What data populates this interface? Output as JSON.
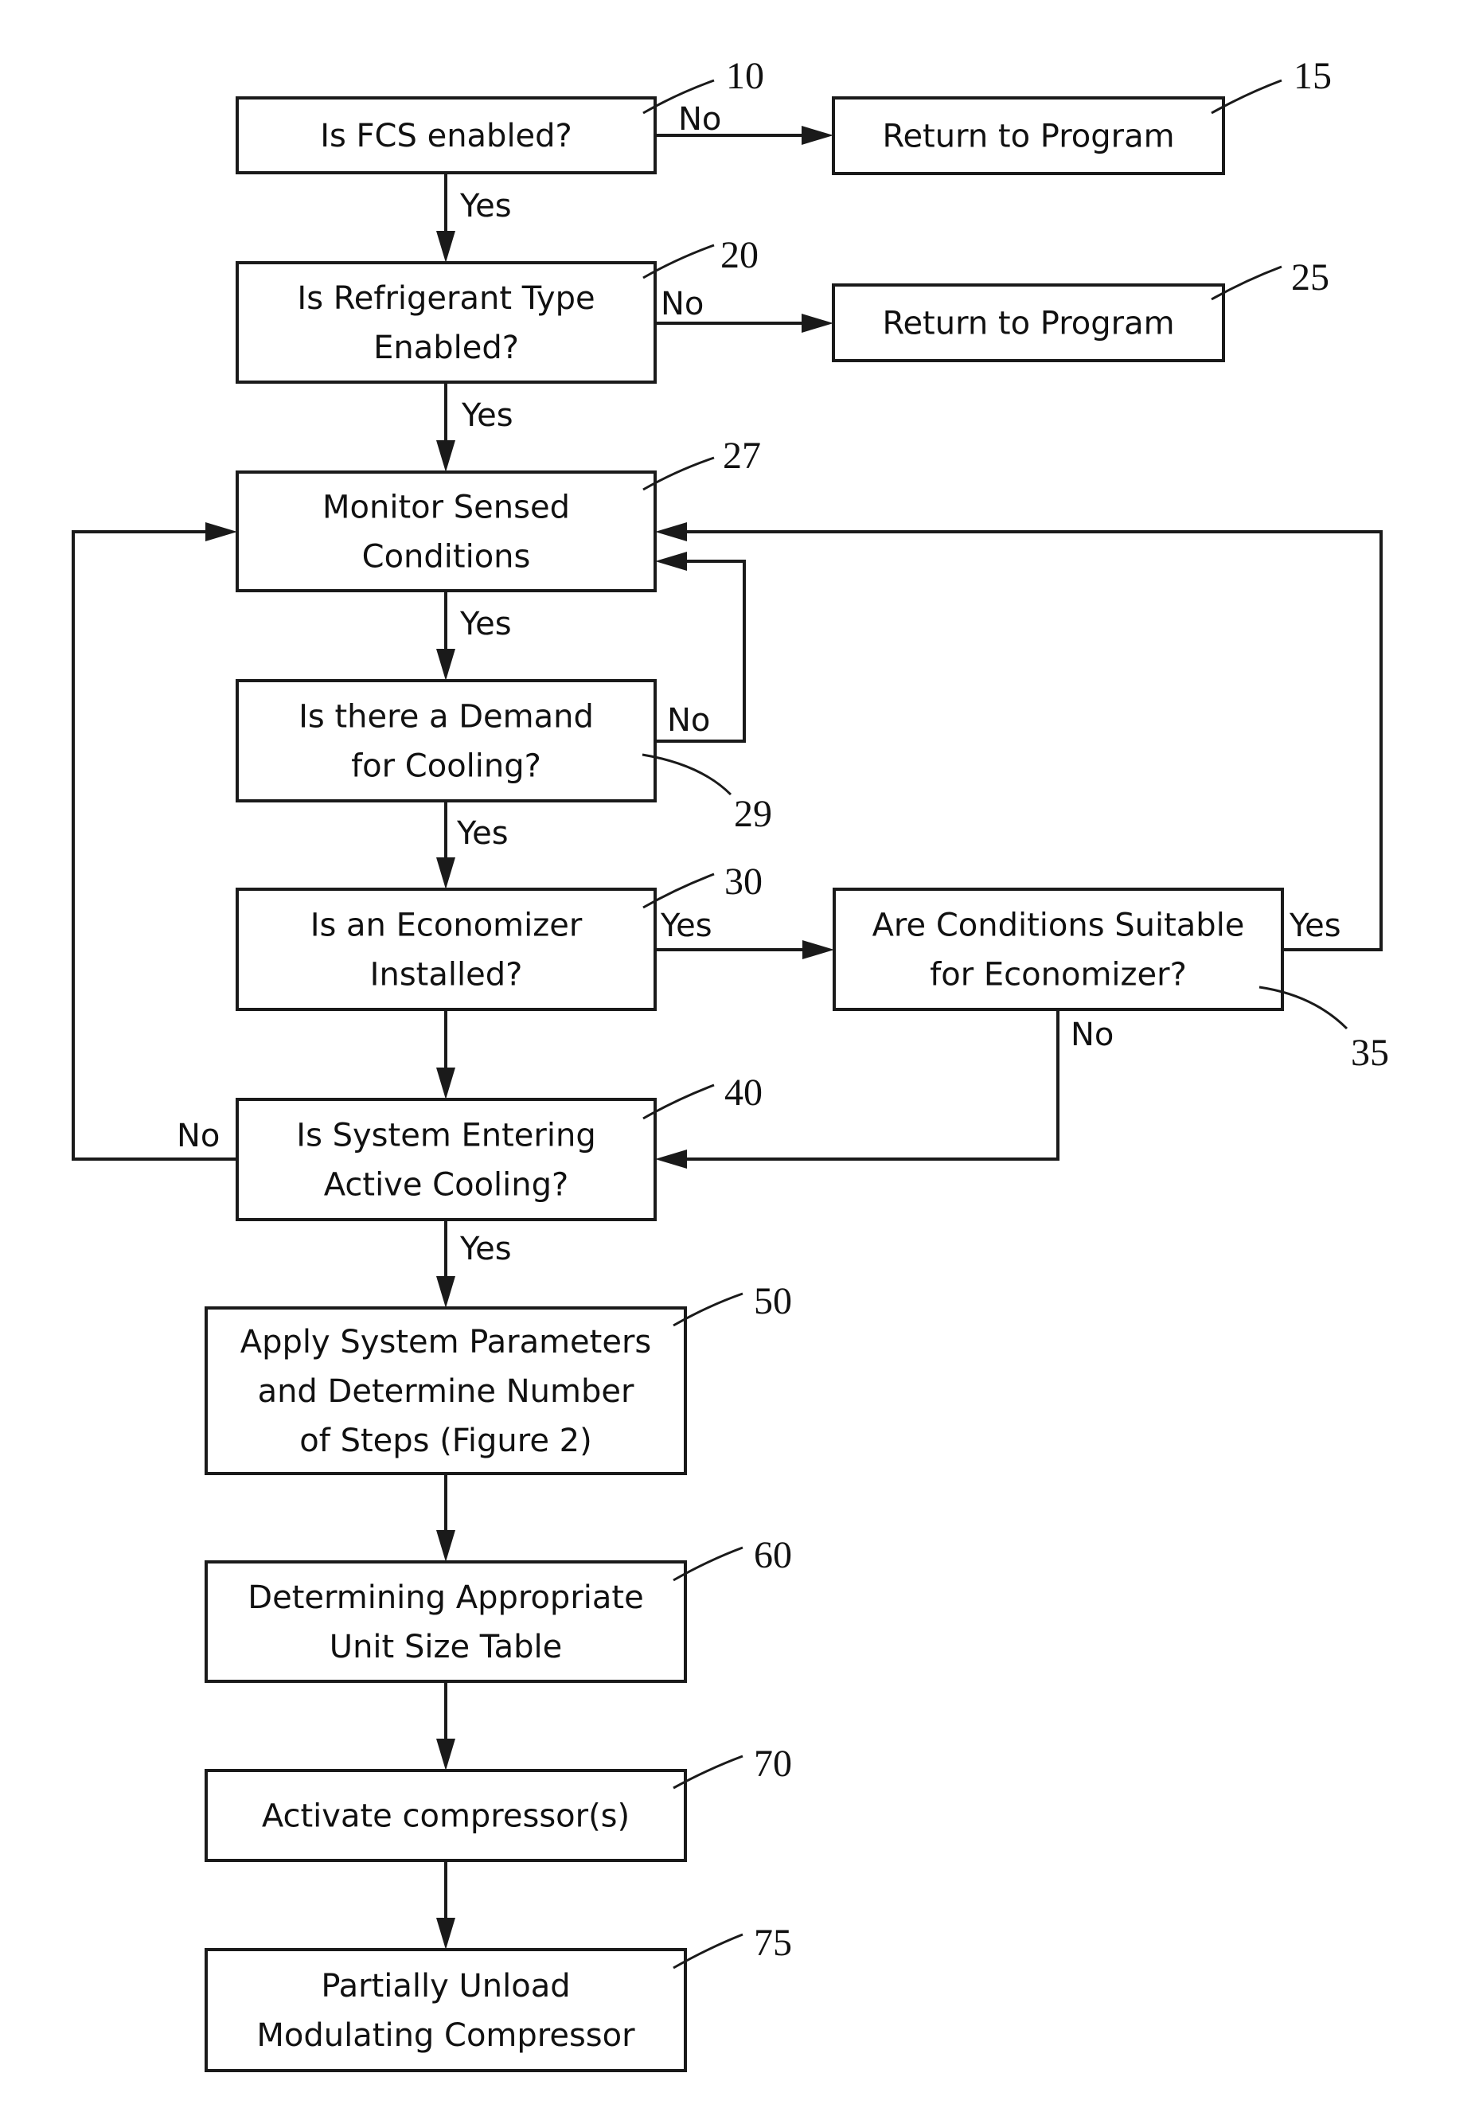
{
  "figure": {
    "type": "flowchart",
    "nodes": [
      {
        "id": "10",
        "ref": "10",
        "lines": [
          "Is FCS enabled?"
        ]
      },
      {
        "id": "15",
        "ref": "15",
        "lines": [
          "Return to Program"
        ]
      },
      {
        "id": "20",
        "ref": "20",
        "lines": [
          "Is Refrigerant Type",
          "Enabled?"
        ]
      },
      {
        "id": "25",
        "ref": "25",
        "lines": [
          "Return to Program"
        ]
      },
      {
        "id": "27",
        "ref": "27",
        "lines": [
          "Monitor Sensed",
          "Conditions"
        ]
      },
      {
        "id": "29",
        "ref": "29",
        "lines": [
          "Is there a Demand",
          "for Cooling?"
        ]
      },
      {
        "id": "30",
        "ref": "30",
        "lines": [
          "Is an Economizer",
          "Installed?"
        ]
      },
      {
        "id": "35",
        "ref": "35",
        "lines": [
          "Are Conditions Suitable",
          "for Economizer?"
        ]
      },
      {
        "id": "40",
        "ref": "40",
        "lines": [
          "Is System Entering",
          "Active Cooling?"
        ]
      },
      {
        "id": "50",
        "ref": "50",
        "lines": [
          "Apply System Parameters",
          "and Determine Number",
          "of Steps (Figure 2)"
        ]
      },
      {
        "id": "60",
        "ref": "60",
        "lines": [
          "Determining Appropriate",
          "Unit Size Table"
        ]
      },
      {
        "id": "70",
        "ref": "70",
        "lines": [
          "Activate compressor(s)"
        ]
      },
      {
        "id": "75",
        "ref": "75",
        "lines": [
          "Partially Unload",
          "Modulating Compressor"
        ]
      }
    ],
    "edges": [
      {
        "id": "e10-15",
        "from": "10",
        "to": "15",
        "label": "No"
      },
      {
        "id": "e10-20",
        "from": "10",
        "to": "20",
        "label": "Yes"
      },
      {
        "id": "e20-25",
        "from": "20",
        "to": "25",
        "label": "No"
      },
      {
        "id": "e20-27",
        "from": "20",
        "to": "27",
        "label": "Yes"
      },
      {
        "id": "e27-29",
        "from": "27",
        "to": "29",
        "label": "Yes"
      },
      {
        "id": "e29-27",
        "from": "29",
        "to": "27",
        "label": "No"
      },
      {
        "id": "e29-30",
        "from": "29",
        "to": "30",
        "label": "Yes"
      },
      {
        "id": "e30-35",
        "from": "30",
        "to": "35",
        "label": "Yes"
      },
      {
        "id": "e30-40",
        "from": "30",
        "to": "40",
        "label": ""
      },
      {
        "id": "e35-27",
        "from": "35",
        "to": "27",
        "label": "Yes"
      },
      {
        "id": "e35-40",
        "from": "35",
        "to": "40",
        "label": "No"
      },
      {
        "id": "e40-27",
        "from": "40",
        "to": "27",
        "label": "No"
      },
      {
        "id": "e40-50",
        "from": "40",
        "to": "50",
        "label": "Yes"
      },
      {
        "id": "e50-60",
        "from": "50",
        "to": "60",
        "label": ""
      },
      {
        "id": "e60-70",
        "from": "60",
        "to": "70",
        "label": ""
      },
      {
        "id": "e70-75",
        "from": "70",
        "to": "75",
        "label": ""
      }
    ]
  }
}
